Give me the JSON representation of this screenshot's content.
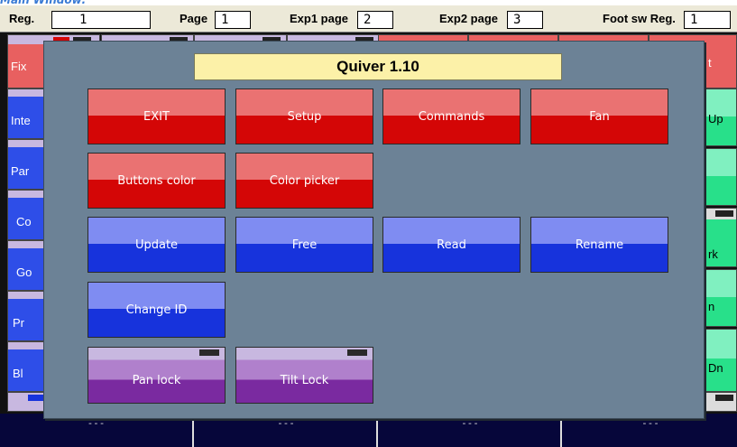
{
  "caption": "Main Window:",
  "topbar": {
    "reg_label": "Reg.",
    "reg_value": "1",
    "page_label": "Page",
    "page_value": "1",
    "exp1_label": "Exp1 page",
    "exp1_value": "2",
    "exp2_label": "Exp2 page",
    "exp2_value": "3",
    "foot_label": "Foot sw Reg.",
    "foot_value": "1"
  },
  "background": {
    "left_labels": [
      "Fix",
      "Inte",
      "Par",
      "Co",
      "Go",
      "Pr",
      "Bl"
    ],
    "right_labels": [
      "t",
      "Up",
      "",
      "rk",
      "n",
      "Dn"
    ],
    "bottom_cells": [
      "---",
      "---",
      "---",
      "---"
    ]
  },
  "modal": {
    "title": "Quiver 1.10",
    "buttons": {
      "exit": "EXIT",
      "setup": "Setup",
      "commands": "Commands",
      "fan": "Fan",
      "buttons_color": "Buttons color",
      "color_picker": "Color picker",
      "update": "Update",
      "free": "Free",
      "read": "Read",
      "rename": "Rename",
      "change_id": "Change ID",
      "pan_lock": "Pan lock",
      "tilt_lock": "Tilt Lock"
    }
  },
  "colors": {
    "red_top": "#ea7272",
    "red_bottom": "#d40606",
    "blue_top": "#7f8cf2",
    "blue_bottom": "#1733dc",
    "purple_mid": "#b080cc",
    "purple_bottom": "#7a2aa0",
    "modal_bg": "#6c8296",
    "title_bg": "#fcf1a8"
  }
}
